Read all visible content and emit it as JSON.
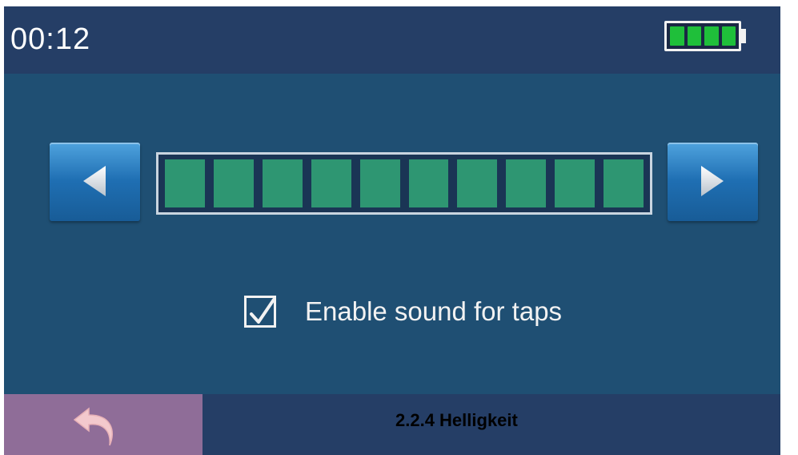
{
  "status_bar": {
    "time": "00:12",
    "battery_icon": "battery-full-icon",
    "battery_level_fraction": 1.0,
    "battery_cells": 4
  },
  "brightness": {
    "level_fraction": 1.0,
    "segments_filled": 10,
    "segments_total": 10,
    "decrease_icon": "arrow-left-icon",
    "increase_icon": "arrow-right-icon"
  },
  "sound": {
    "checked": true,
    "label": "Enable sound for taps"
  },
  "bottom_bar": {
    "back_icon": "back-arrow-icon"
  },
  "caption": "2.2.4 Helligkeit",
  "colors": {
    "screen_bg": "#1f4f73",
    "bar_bg": "#253e66",
    "segment": "#2e9672",
    "battery_cell": "#1fbf3a",
    "button_blue": "#1f6fb3",
    "back_button": "#8f6d98"
  }
}
